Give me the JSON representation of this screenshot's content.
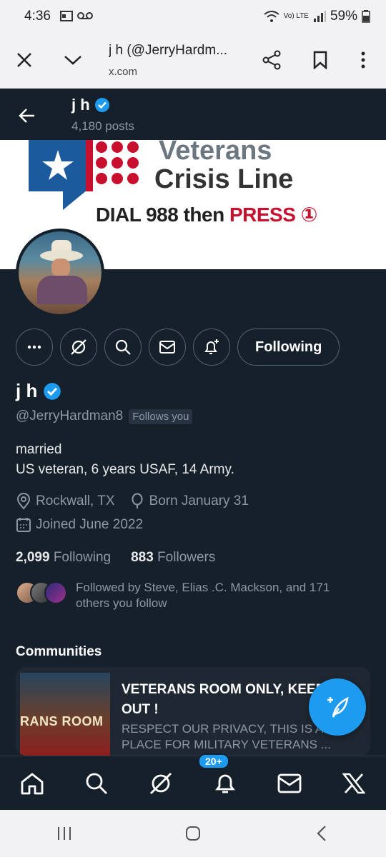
{
  "status": {
    "time": "4:36",
    "battery": "59%",
    "network": "Vo) LTE"
  },
  "browser": {
    "title": "j h (@JerryHardm...",
    "domain": "x.com"
  },
  "profile_header": {
    "name": "j h",
    "posts": "4,180 posts"
  },
  "banner": {
    "line1": "Veterans",
    "line2": "Crisis Line",
    "line3_a": "DIAL 988 then ",
    "line3_b": "PRESS ①"
  },
  "actions": {
    "following_label": "Following"
  },
  "profile": {
    "name": "j h",
    "handle": "@JerryHardman8",
    "follows_you": "Follows you",
    "bio_line1": "married",
    "bio_line2": "US veteran,  6 years USAF, 14 Army.",
    "location": "Rockwall, TX",
    "born": "Born January 31",
    "joined": "Joined June 2022",
    "following_count": "2,099",
    "following_label": "Following",
    "followers_count": "883",
    "followers_label": "Followers",
    "followed_by": "Followed by Steve, Elias .C. Mackson, and 171 others you follow"
  },
  "communities": {
    "heading": "Communities",
    "card": {
      "thumb_text": "RANS ROOM",
      "title": "VETERANS ROOM ONLY, KEEP OUT !",
      "description": "RESPECT OUR PRIVACY, THIS IS A PLACE FOR MILITARY VETERANS ..."
    }
  },
  "nav": {
    "notifications_badge": "20+"
  },
  "colors": {
    "background": "#15202b",
    "accent": "#1d9bf0",
    "muted": "#8b98a5"
  }
}
